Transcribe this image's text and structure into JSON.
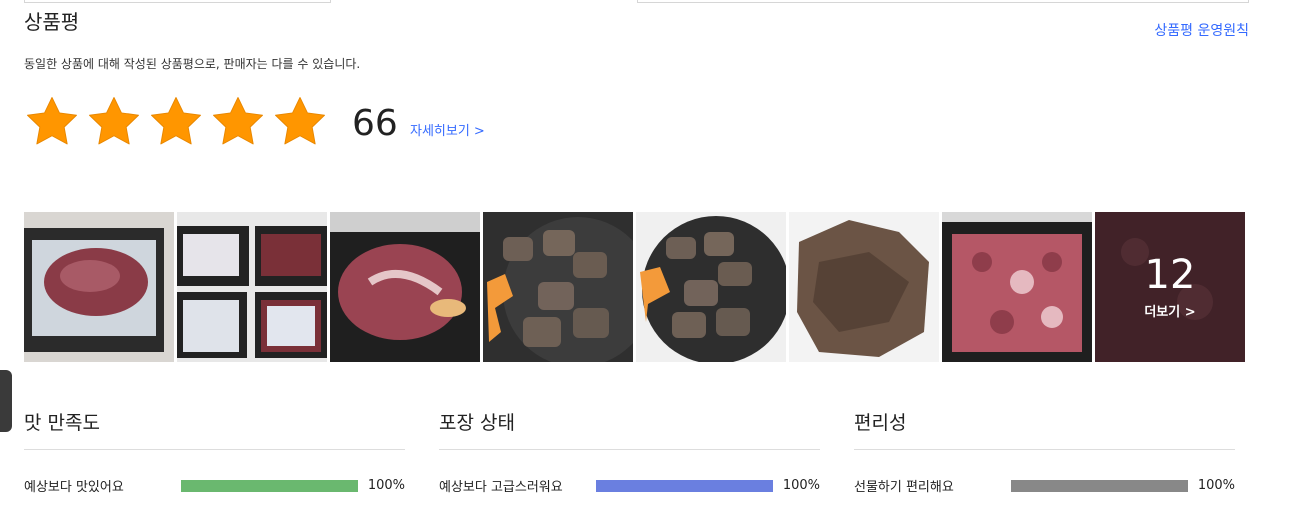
{
  "header": {
    "title": "상품평",
    "policy_link": "상품평 운영원칙",
    "notice": "동일한 상품에 대해 작성된 상품평으로, 판매자는 다를 수 있습니다."
  },
  "rating": {
    "stars": 5,
    "max_stars": 5,
    "count": "66",
    "detail_link": "자세히보기 >",
    "star_color": "#ff9600"
  },
  "photos": {
    "items": [
      {
        "alt": "beef-in-tray"
      },
      {
        "alt": "packaged-portions"
      },
      {
        "alt": "marbled-steak"
      },
      {
        "alt": "grilled-beef-pan"
      },
      {
        "alt": "grilled-beef-pan-2"
      },
      {
        "alt": "cooked-beef"
      },
      {
        "alt": "diced-beef-tray"
      },
      {
        "alt": "more-photos"
      }
    ],
    "more_count": "12",
    "more_label": "더보기 >"
  },
  "summary": [
    {
      "title": "맛 만족도",
      "label": "예상보다 맛있어요",
      "percent": "100%",
      "value": 100,
      "color": "#6ab86f"
    },
    {
      "title": "포장 상태",
      "label": "예상보다 고급스러워요",
      "percent": "100%",
      "value": 100,
      "color": "#6a7fe0"
    },
    {
      "title": "편리성",
      "label": "선물하기 편리해요",
      "percent": "100%",
      "value": 100,
      "color": "#888888"
    }
  ]
}
